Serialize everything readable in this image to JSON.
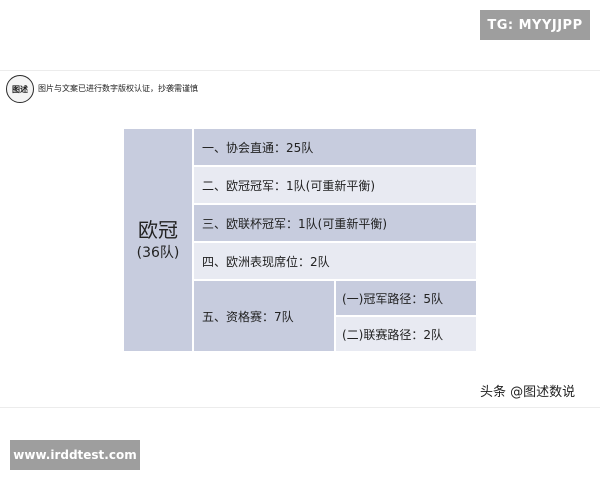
{
  "badges": {
    "tg": "TG: MYYJJPP",
    "site": "www.irddtest.com"
  },
  "slide": {
    "logo_text": "图述",
    "notice": "图片与文案已进行数字版权认证，抄袭需谨慎",
    "watermark": "头条 @图述数说"
  },
  "table": {
    "main_title": "欧冠",
    "main_count": "(36队)",
    "rows": [
      "一、协会直通：25队",
      "二、欧冠冠军：1队(可重新平衡)",
      "三、欧联杯冠军：1队(可重新平衡)",
      "四、欧洲表现席位：2队",
      "五、资格赛：7队"
    ],
    "sub_rows": [
      "(一)冠军路径：5队",
      "(二)联赛路径：2队"
    ]
  },
  "colors": {
    "dark_cell": "#c7ccde",
    "light_cell": "#e8eaf2",
    "badge_bg": "#9e9e9e"
  }
}
